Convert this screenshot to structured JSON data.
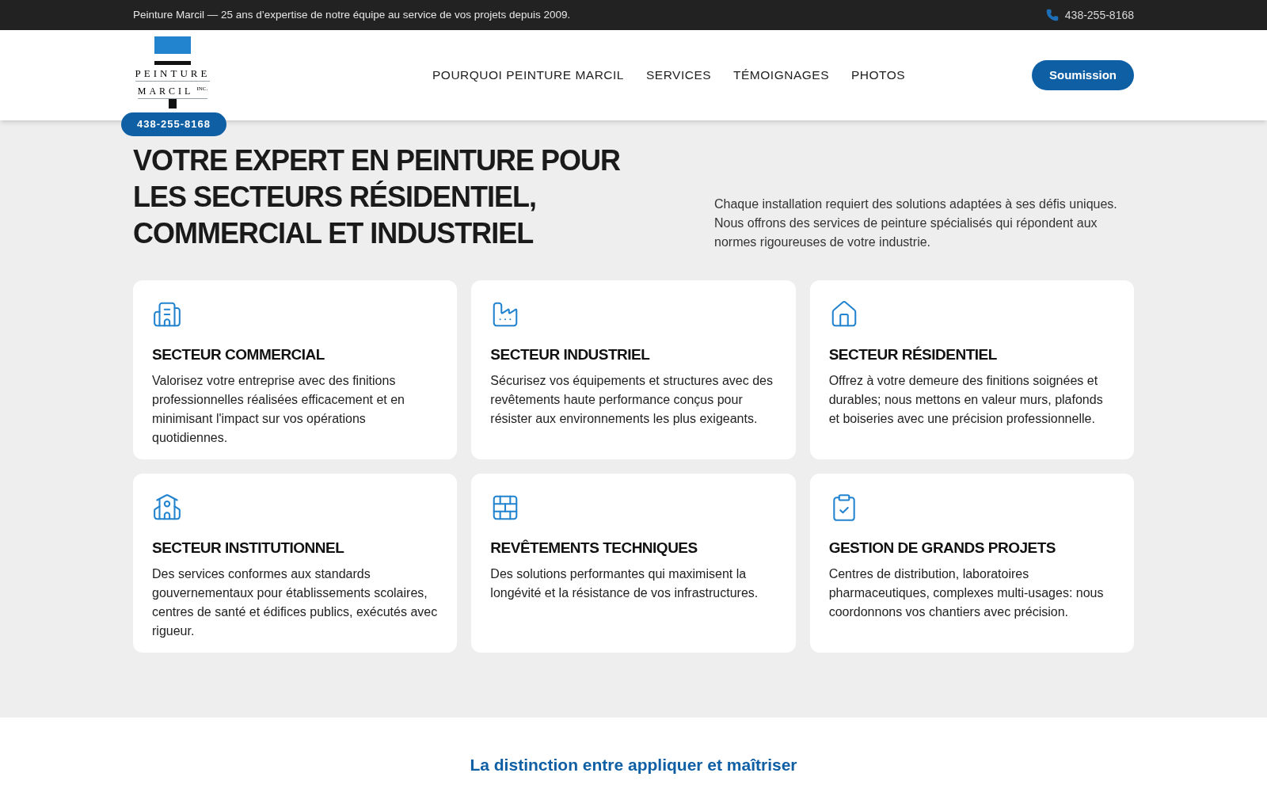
{
  "top_bar": {
    "tagline": "Peinture Marcil — 25 ans d’expertise de notre équipe au service de vos projets depuis 2009.",
    "phone": "438-255-8168"
  },
  "header": {
    "logo": {
      "line_1": "PEINTURE",
      "line_2": "MARCIL",
      "suffix": "INC."
    },
    "phone_badge": "438-255-8168",
    "nav": [
      {
        "label": "POURQUOI PEINTURE MARCIL"
      },
      {
        "label": "SERVICES"
      },
      {
        "label": "TÉMOIGNAGES"
      },
      {
        "label": "PHOTOS"
      }
    ],
    "cta": "Soumission"
  },
  "hero": {
    "title": "VOTRE EXPERT EN PEINTURE POUR LES SECTEURS RÉSIDENTIEL, COMMERCIAL ET INDUSTRIEL",
    "intro": "Chaque installation requiert des solutions adaptées à ses défis uniques. Nous offrons des services de peinture spécialisés qui répondent aux normes rigoureuses de votre industrie."
  },
  "cards": [
    {
      "title": "SECTEUR COMMERCIAL",
      "text": "Valorisez votre entreprise avec des finitions professionnelles réalisées efficacement et en minimisant l'impact sur vos opérations quotidiennes."
    },
    {
      "title": "SECTEUR INDUSTRIEL",
      "text": "Sécurisez vos équipements et structures avec des revêtements haute performance conçus pour résister aux environnements les plus exigeants."
    },
    {
      "title": "SECTEUR RÉSIDENTIEL",
      "text": "Offrez à votre demeure des finitions soignées et durables; nous mettons en valeur murs, plafonds et boiseries avec une précision professionnelle."
    },
    {
      "title": "SECTEUR INSTITUTIONNEL",
      "text": "Des services conformes aux standards gouvernementaux pour établissements scolaires, centres de santé et édifices publics, exécutés avec rigueur."
    },
    {
      "title": "REVÊTEMENTS TECHNIQUES",
      "text": "Des solutions performantes qui maximisent la longévité et la résistance de vos infrastructures."
    },
    {
      "title": "GESTION DE GRANDS PROJETS",
      "text": "Centres de distribution, laboratoires pharmaceutiques, complexes multi-usages: nous coordonnons vos chantiers avec précision."
    }
  ],
  "next_section": {
    "title": "La distinction entre appliquer et maîtriser"
  }
}
